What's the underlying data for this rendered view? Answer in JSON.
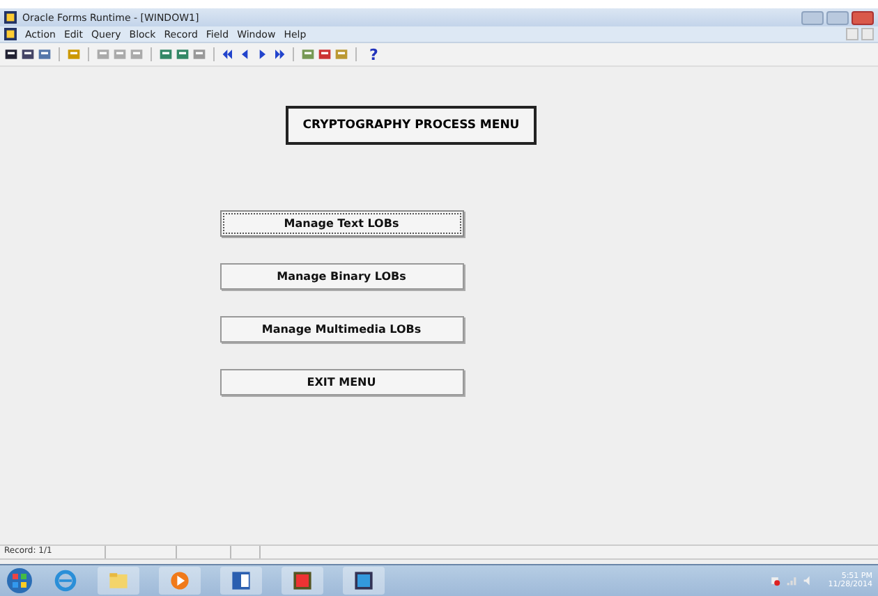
{
  "window": {
    "title": "Oracle Forms Runtime - [WINDOW1]"
  },
  "menu": [
    "Action",
    "Edit",
    "Query",
    "Block",
    "Record",
    "Field",
    "Window",
    "Help"
  ],
  "toolbar": {
    "help_glyph": "?"
  },
  "form": {
    "title": "CRYPTOGRAPHY PROCESS MENU",
    "buttons": [
      {
        "label": "Manage Text LOBs",
        "focused": true
      },
      {
        "label": "Manage Binary LOBs",
        "focused": false
      },
      {
        "label": "Manage Multimedia LOBs",
        "focused": false
      },
      {
        "label": "EXIT MENU",
        "focused": false
      }
    ]
  },
  "status_bar": {
    "record": "Record: 1/1"
  },
  "taskbar": {
    "time": "5:51 PM",
    "date": "11/28/2014"
  }
}
